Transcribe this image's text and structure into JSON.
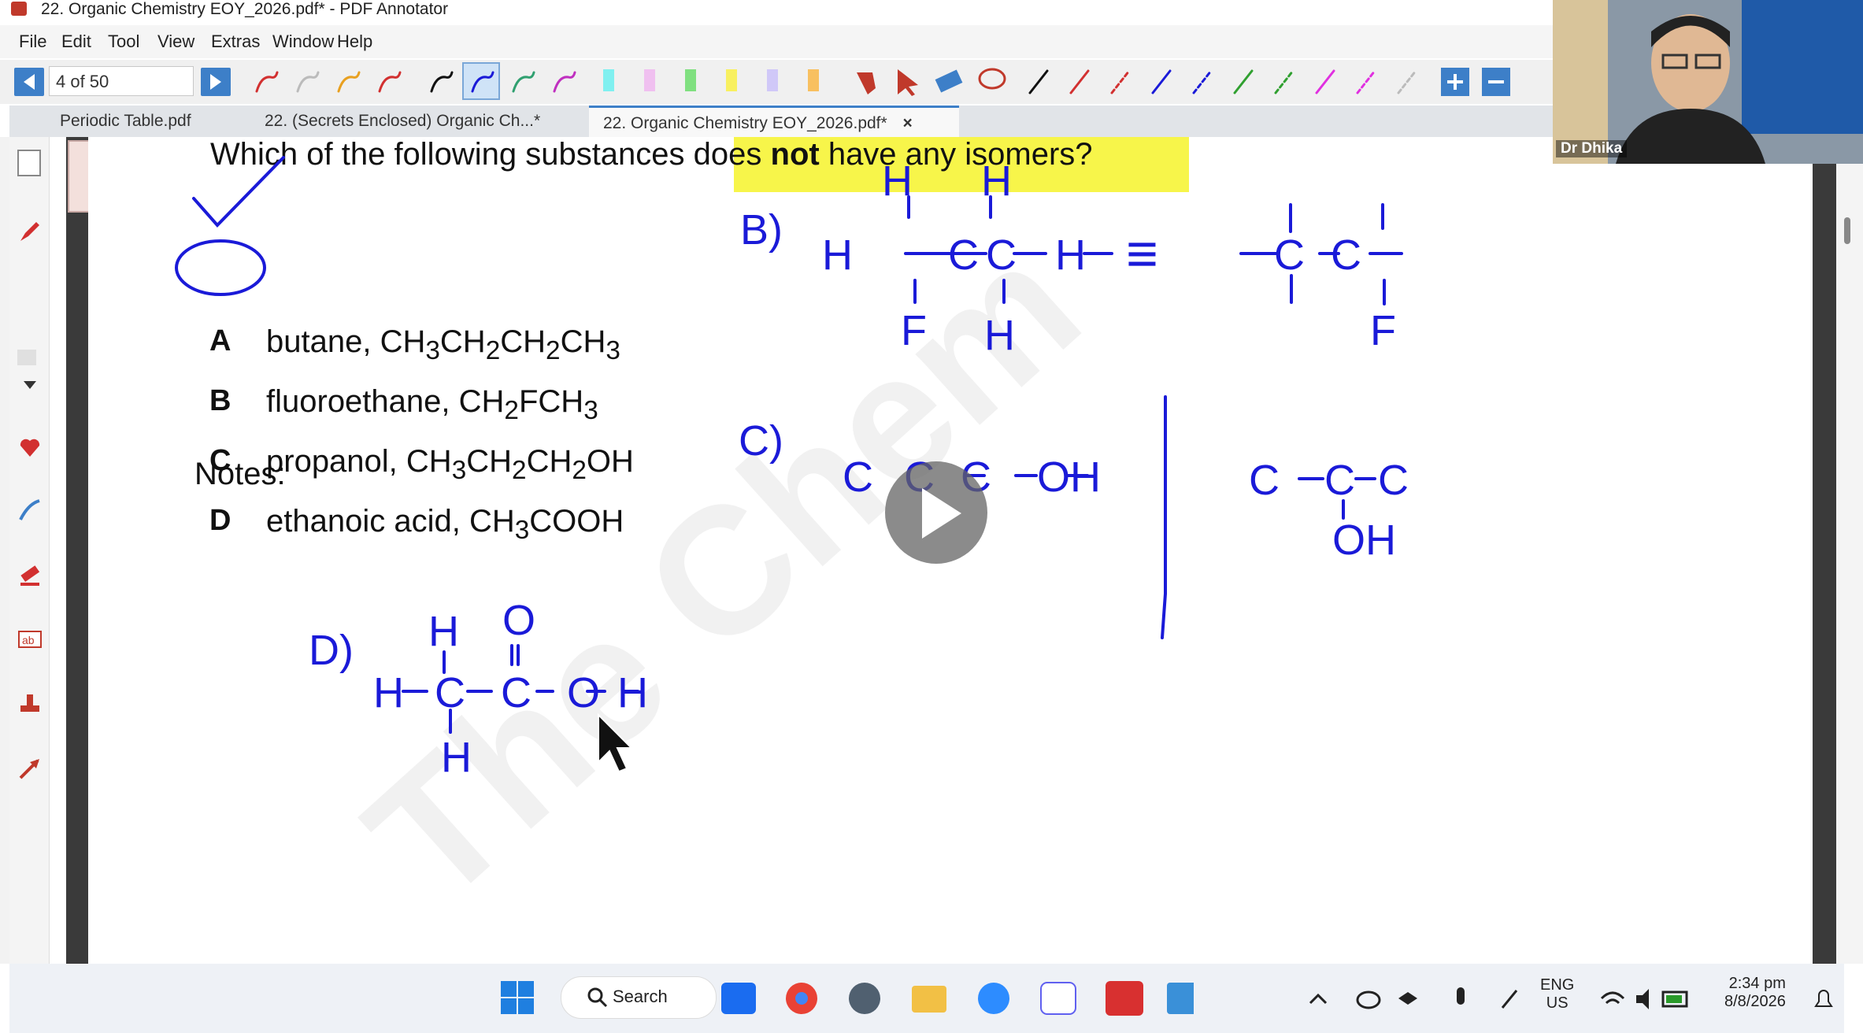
{
  "window": {
    "title": "22. Organic Chemistry EOY_2026.pdf* - PDF Annotator"
  },
  "menu": [
    "File",
    "Edit",
    "Tool",
    "View",
    "Extras",
    "Window",
    "Help"
  ],
  "toolbar": {
    "page_indicator": "4 of 50"
  },
  "tabs": [
    {
      "label": "Periodic Table.pdf"
    },
    {
      "label": "22. (Secrets Enclosed) Organic Ch...*"
    },
    {
      "label": "22. Organic Chemistry EOY_2026.pdf*"
    }
  ],
  "tab_close_icon": "×",
  "document": {
    "question_pre": "Which of the following substances ",
    "question_hl1": "does ",
    "question_bold": "not",
    "question_hl2": " have any isomers?",
    "options": [
      {
        "letter": "A",
        "name": "butane, ",
        "formula": [
          "CH",
          "3",
          "CH",
          "2",
          "CH",
          "2",
          "CH",
          "3"
        ]
      },
      {
        "letter": "B",
        "name": "fluoroethane, ",
        "formula": [
          "CH",
          "2",
          "FCH",
          "3"
        ]
      },
      {
        "letter": "C",
        "name": "propanol, ",
        "formula": [
          "CH",
          "3",
          "CH",
          "2",
          "CH",
          "2",
          "OH"
        ]
      },
      {
        "letter": "D",
        "name": "ethanoic acid, ",
        "formula": [
          "CH",
          "3",
          "COOH"
        ]
      }
    ],
    "notes_label": "Notes:",
    "watermark": "The Chem"
  },
  "handwriting": {
    "b_label": "B)",
    "c_label": "C)",
    "d_label": "D)",
    "equiv": "≡",
    "H": "H",
    "C": "C",
    "F": "F",
    "O": "O",
    "OH": "OH"
  },
  "webcam": {
    "name": "Dr Dhika"
  },
  "taskbar": {
    "search": "Search",
    "lang_line1": "ENG",
    "lang_line2": "US",
    "time": "2:34 pm",
    "date": "8/8/2026"
  },
  "colors": {
    "ink": "#1a1ad8",
    "highlight": "#f7f54a",
    "accent": "#3d7fc8"
  }
}
